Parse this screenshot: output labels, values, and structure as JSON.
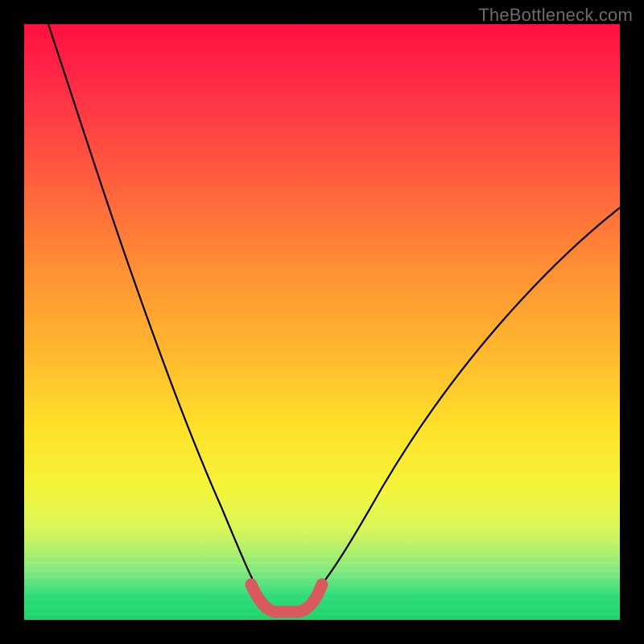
{
  "watermark": "TheBottleneck.com",
  "colors": {
    "frame": "#000000",
    "gradient_top": "#ff1040",
    "gradient_bottom": "#1fd46a",
    "curve": "#000000",
    "highlight": "#d85a5f"
  },
  "chart_data": {
    "type": "line",
    "title": "",
    "xlabel": "",
    "ylabel": "",
    "xlim": [
      0,
      100
    ],
    "ylim": [
      0,
      100
    ],
    "annotations": [
      "watermark top-right: TheBottleneck.com"
    ],
    "series": [
      {
        "name": "bottleneck-curve-left",
        "x": [
          4,
          8,
          12,
          16,
          20,
          24,
          28,
          32,
          35,
          37,
          39
        ],
        "y": [
          100,
          90,
          79,
          68,
          56,
          44,
          32,
          20,
          10,
          5,
          2
        ]
      },
      {
        "name": "bottleneck-curve-right",
        "x": [
          48,
          51,
          55,
          60,
          66,
          73,
          81,
          90,
          100
        ],
        "y": [
          2,
          5,
          11,
          19,
          28,
          37,
          46,
          55,
          63
        ]
      },
      {
        "name": "valley-floor-highlight",
        "x": [
          38,
          40,
          42,
          44,
          46,
          48
        ],
        "y": [
          3,
          1,
          0.5,
          0.5,
          1,
          3
        ]
      }
    ]
  }
}
